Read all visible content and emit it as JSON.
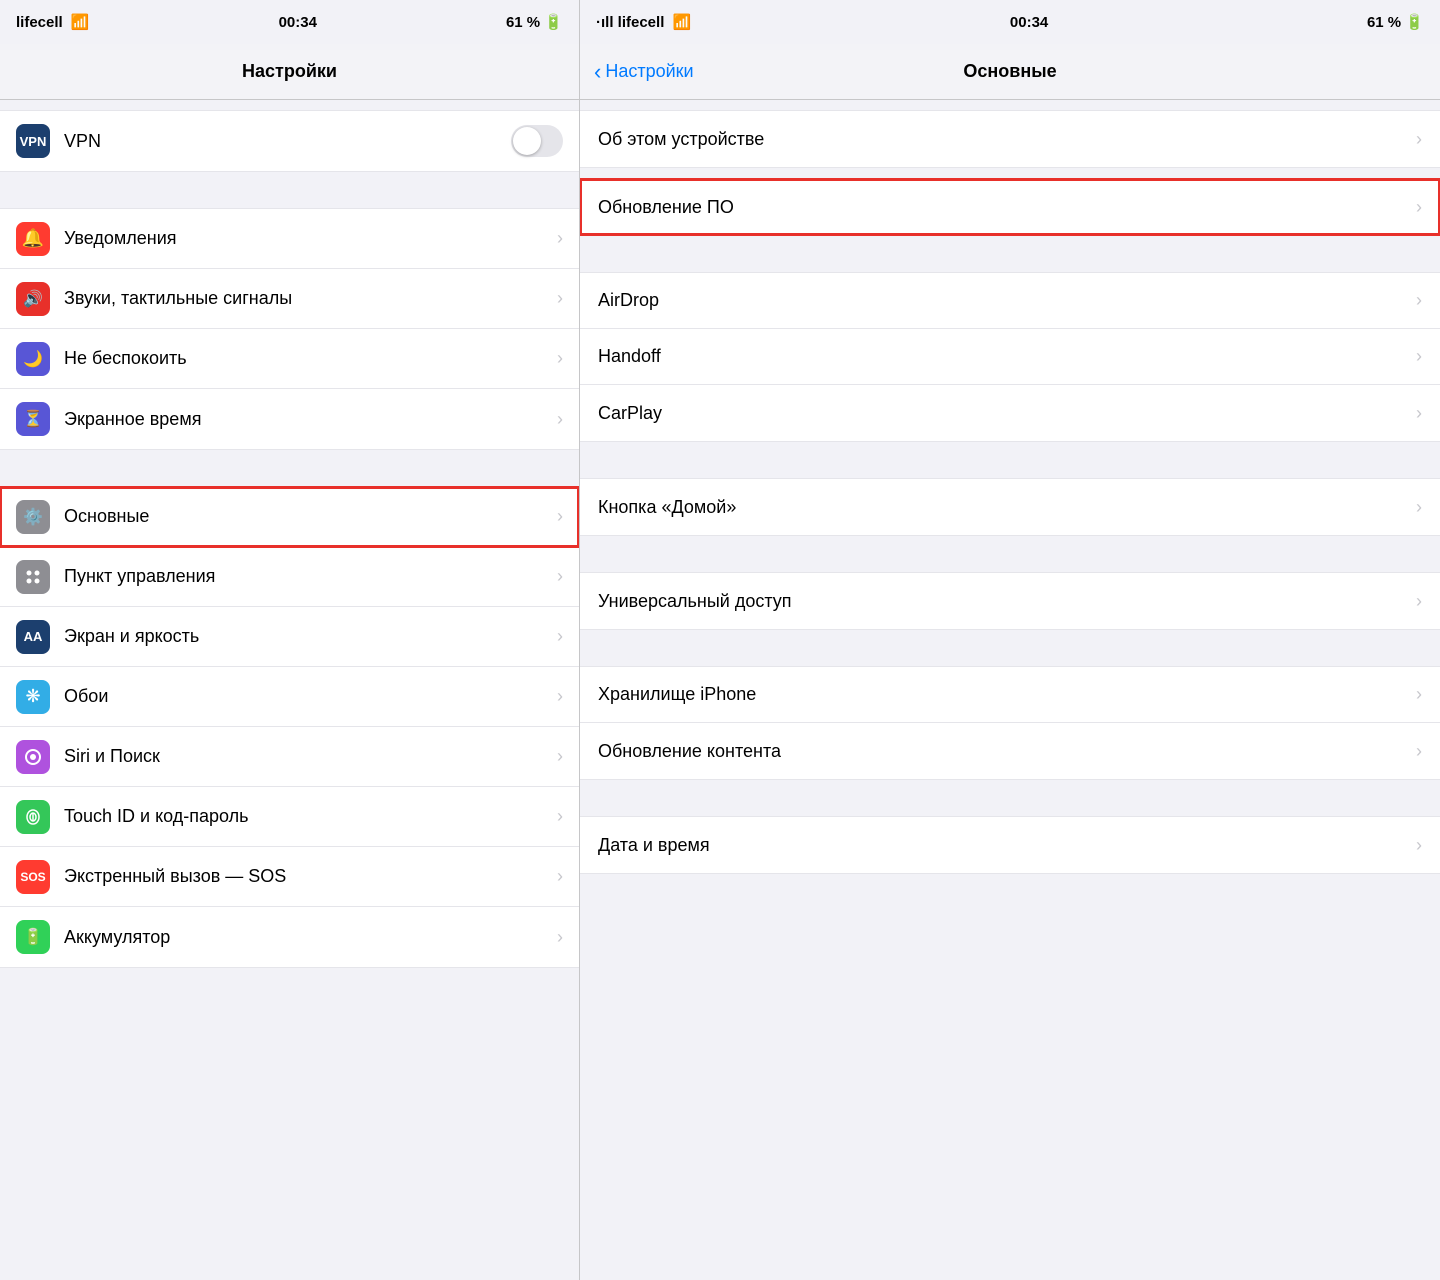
{
  "statusBars": {
    "left": {
      "carrier": "lifecell",
      "time": "00:34",
      "battery": "61 %"
    },
    "right": {
      "carrier": "lifecell",
      "time": "00:34",
      "battery": "61 %"
    }
  },
  "leftPanel": {
    "title": "Настройки",
    "vpnSection": {
      "label": "VPN",
      "toggleOff": true
    },
    "sections": [
      {
        "items": [
          {
            "id": "notifications",
            "icon": "bell",
            "iconBg": "icon-red2",
            "label": "Уведомления",
            "hasChevron": true
          },
          {
            "id": "sounds",
            "icon": "speaker",
            "iconBg": "icon-red",
            "label": "Звуки, тактильные сигналы",
            "hasChevron": true
          },
          {
            "id": "dnd",
            "icon": "moon",
            "iconBg": "icon-indigo",
            "label": "Не беспокоить",
            "hasChevron": true
          },
          {
            "id": "screentime",
            "icon": "hourglass",
            "iconBg": "icon-indigo",
            "label": "Экранное время",
            "hasChevron": true
          }
        ]
      },
      {
        "items": [
          {
            "id": "general",
            "icon": "gear",
            "iconBg": "icon-gray",
            "label": "Основные",
            "hasChevron": true,
            "highlighted": true
          },
          {
            "id": "controlcenter",
            "icon": "sliders",
            "iconBg": "icon-gray",
            "label": "Пункт управления",
            "hasChevron": true
          },
          {
            "id": "display",
            "icon": "AA",
            "iconBg": "icon-dark-blue",
            "label": "Экран и яркость",
            "hasChevron": true
          },
          {
            "id": "wallpaper",
            "icon": "flower",
            "iconBg": "icon-teal",
            "label": "Обои",
            "hasChevron": true
          },
          {
            "id": "siri",
            "icon": "siri",
            "iconBg": "icon-purple",
            "label": "Siri и Поиск",
            "hasChevron": true
          },
          {
            "id": "touchid",
            "icon": "fingerprint",
            "iconBg": "icon-green",
            "label": "Touch ID и код-пароль",
            "hasChevron": true
          },
          {
            "id": "sos",
            "icon": "SOS",
            "iconBg": "icon-sos",
            "label": "Экстренный вызов — SOS",
            "hasChevron": true
          },
          {
            "id": "battery",
            "icon": "battery",
            "iconBg": "icon-green2",
            "label": "Аккумулятор",
            "hasChevron": true
          }
        ]
      }
    ]
  },
  "rightPanel": {
    "backLabel": "Настройки",
    "title": "Основные",
    "sections": [
      {
        "items": [
          {
            "id": "about",
            "label": "Об этом устройстве",
            "hasChevron": true
          }
        ]
      },
      {
        "items": [
          {
            "id": "software-update",
            "label": "Обновление ПО",
            "hasChevron": true,
            "highlighted": true
          }
        ]
      },
      {
        "items": [
          {
            "id": "airdrop",
            "label": "AirDrop",
            "hasChevron": true
          },
          {
            "id": "handoff",
            "label": "Handoff",
            "hasChevron": true
          },
          {
            "id": "carplay",
            "label": "CarPlay",
            "hasChevron": true
          }
        ]
      },
      {
        "items": [
          {
            "id": "home-button",
            "label": "Кнопка «Домой»",
            "hasChevron": true
          }
        ]
      },
      {
        "items": [
          {
            "id": "accessibility",
            "label": "Универсальный доступ",
            "hasChevron": true
          }
        ]
      },
      {
        "items": [
          {
            "id": "storage",
            "label": "Хранилище iPhone",
            "hasChevron": true
          },
          {
            "id": "background-refresh",
            "label": "Обновление контента",
            "hasChevron": true
          }
        ]
      },
      {
        "items": [
          {
            "id": "datetime",
            "label": "Дата и время",
            "hasChevron": true
          }
        ]
      }
    ]
  },
  "icons": {
    "bell": "🔔",
    "speaker": "🔊",
    "moon": "🌙",
    "hourglass": "⏳",
    "gear": "⚙️",
    "sliders": "⚙",
    "AA": "AA",
    "flower": "❋",
    "siri": "◉",
    "fingerprint": "✦",
    "SOS": "SOS",
    "battery": "🔋"
  }
}
